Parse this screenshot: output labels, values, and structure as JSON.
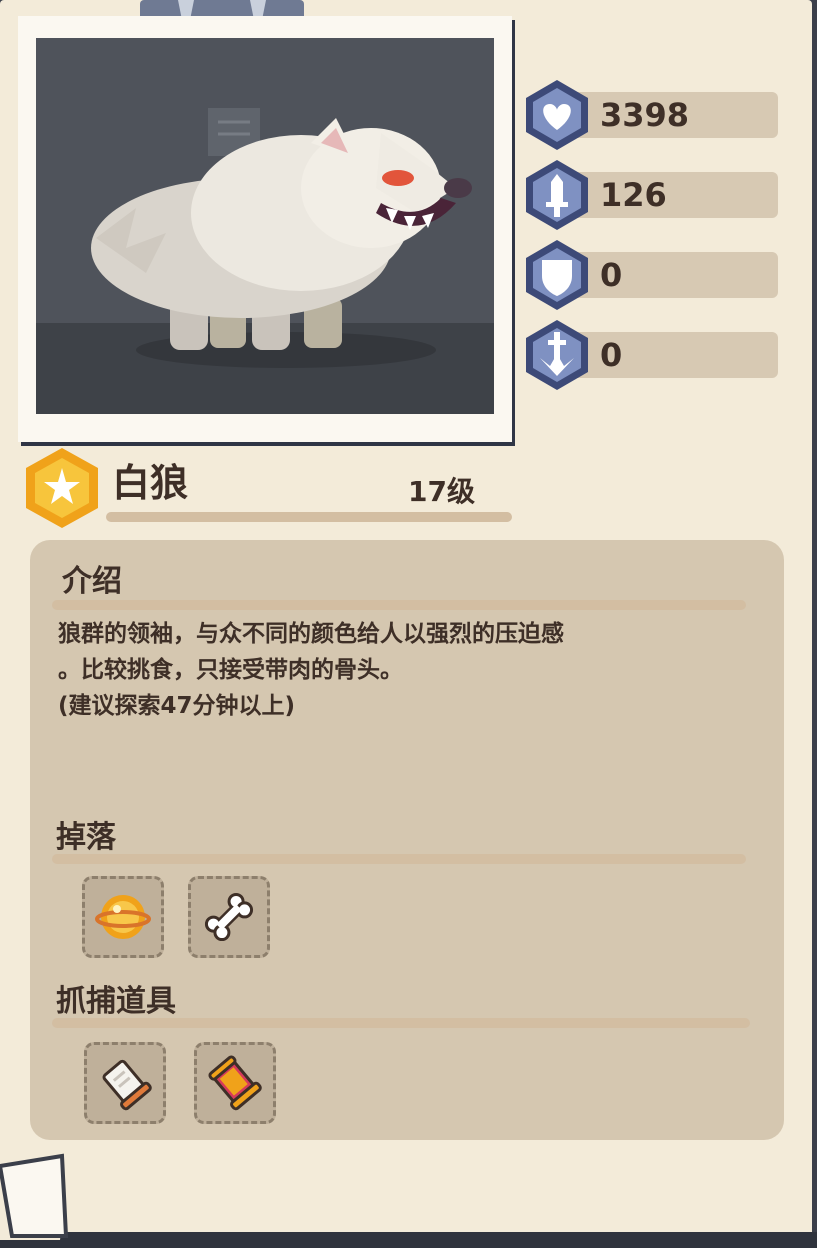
{
  "monster": {
    "name": "白狼",
    "level": "17级"
  },
  "stats": [
    {
      "icon": "heart-icon",
      "value": "3398"
    },
    {
      "icon": "sword-icon",
      "value": "126"
    },
    {
      "icon": "shield-icon",
      "value": "0"
    },
    {
      "icon": "pierce-sword-icon",
      "value": "0"
    }
  ],
  "intro": {
    "title": "介绍",
    "line1": "狼群的领袖，与众不同的颜色给人以强烈的压迫感",
    "line2": "。比较挑食，只接受带肉的骨头。",
    "line3": "(建议探索47分钟以上)"
  },
  "drops": {
    "title": "掉落",
    "items": [
      "gold-coin-icon",
      "bone-icon"
    ]
  },
  "capture": {
    "title": "抓捕道具",
    "items": [
      "white-scroll-icon",
      "red-scroll-icon"
    ]
  },
  "colors": {
    "paper": "#f3ebd9",
    "panel": "#d5c7b0",
    "stat_hex": "#3d4a78",
    "text": "#3e2f27",
    "badge_gold": "#f0a21a"
  }
}
